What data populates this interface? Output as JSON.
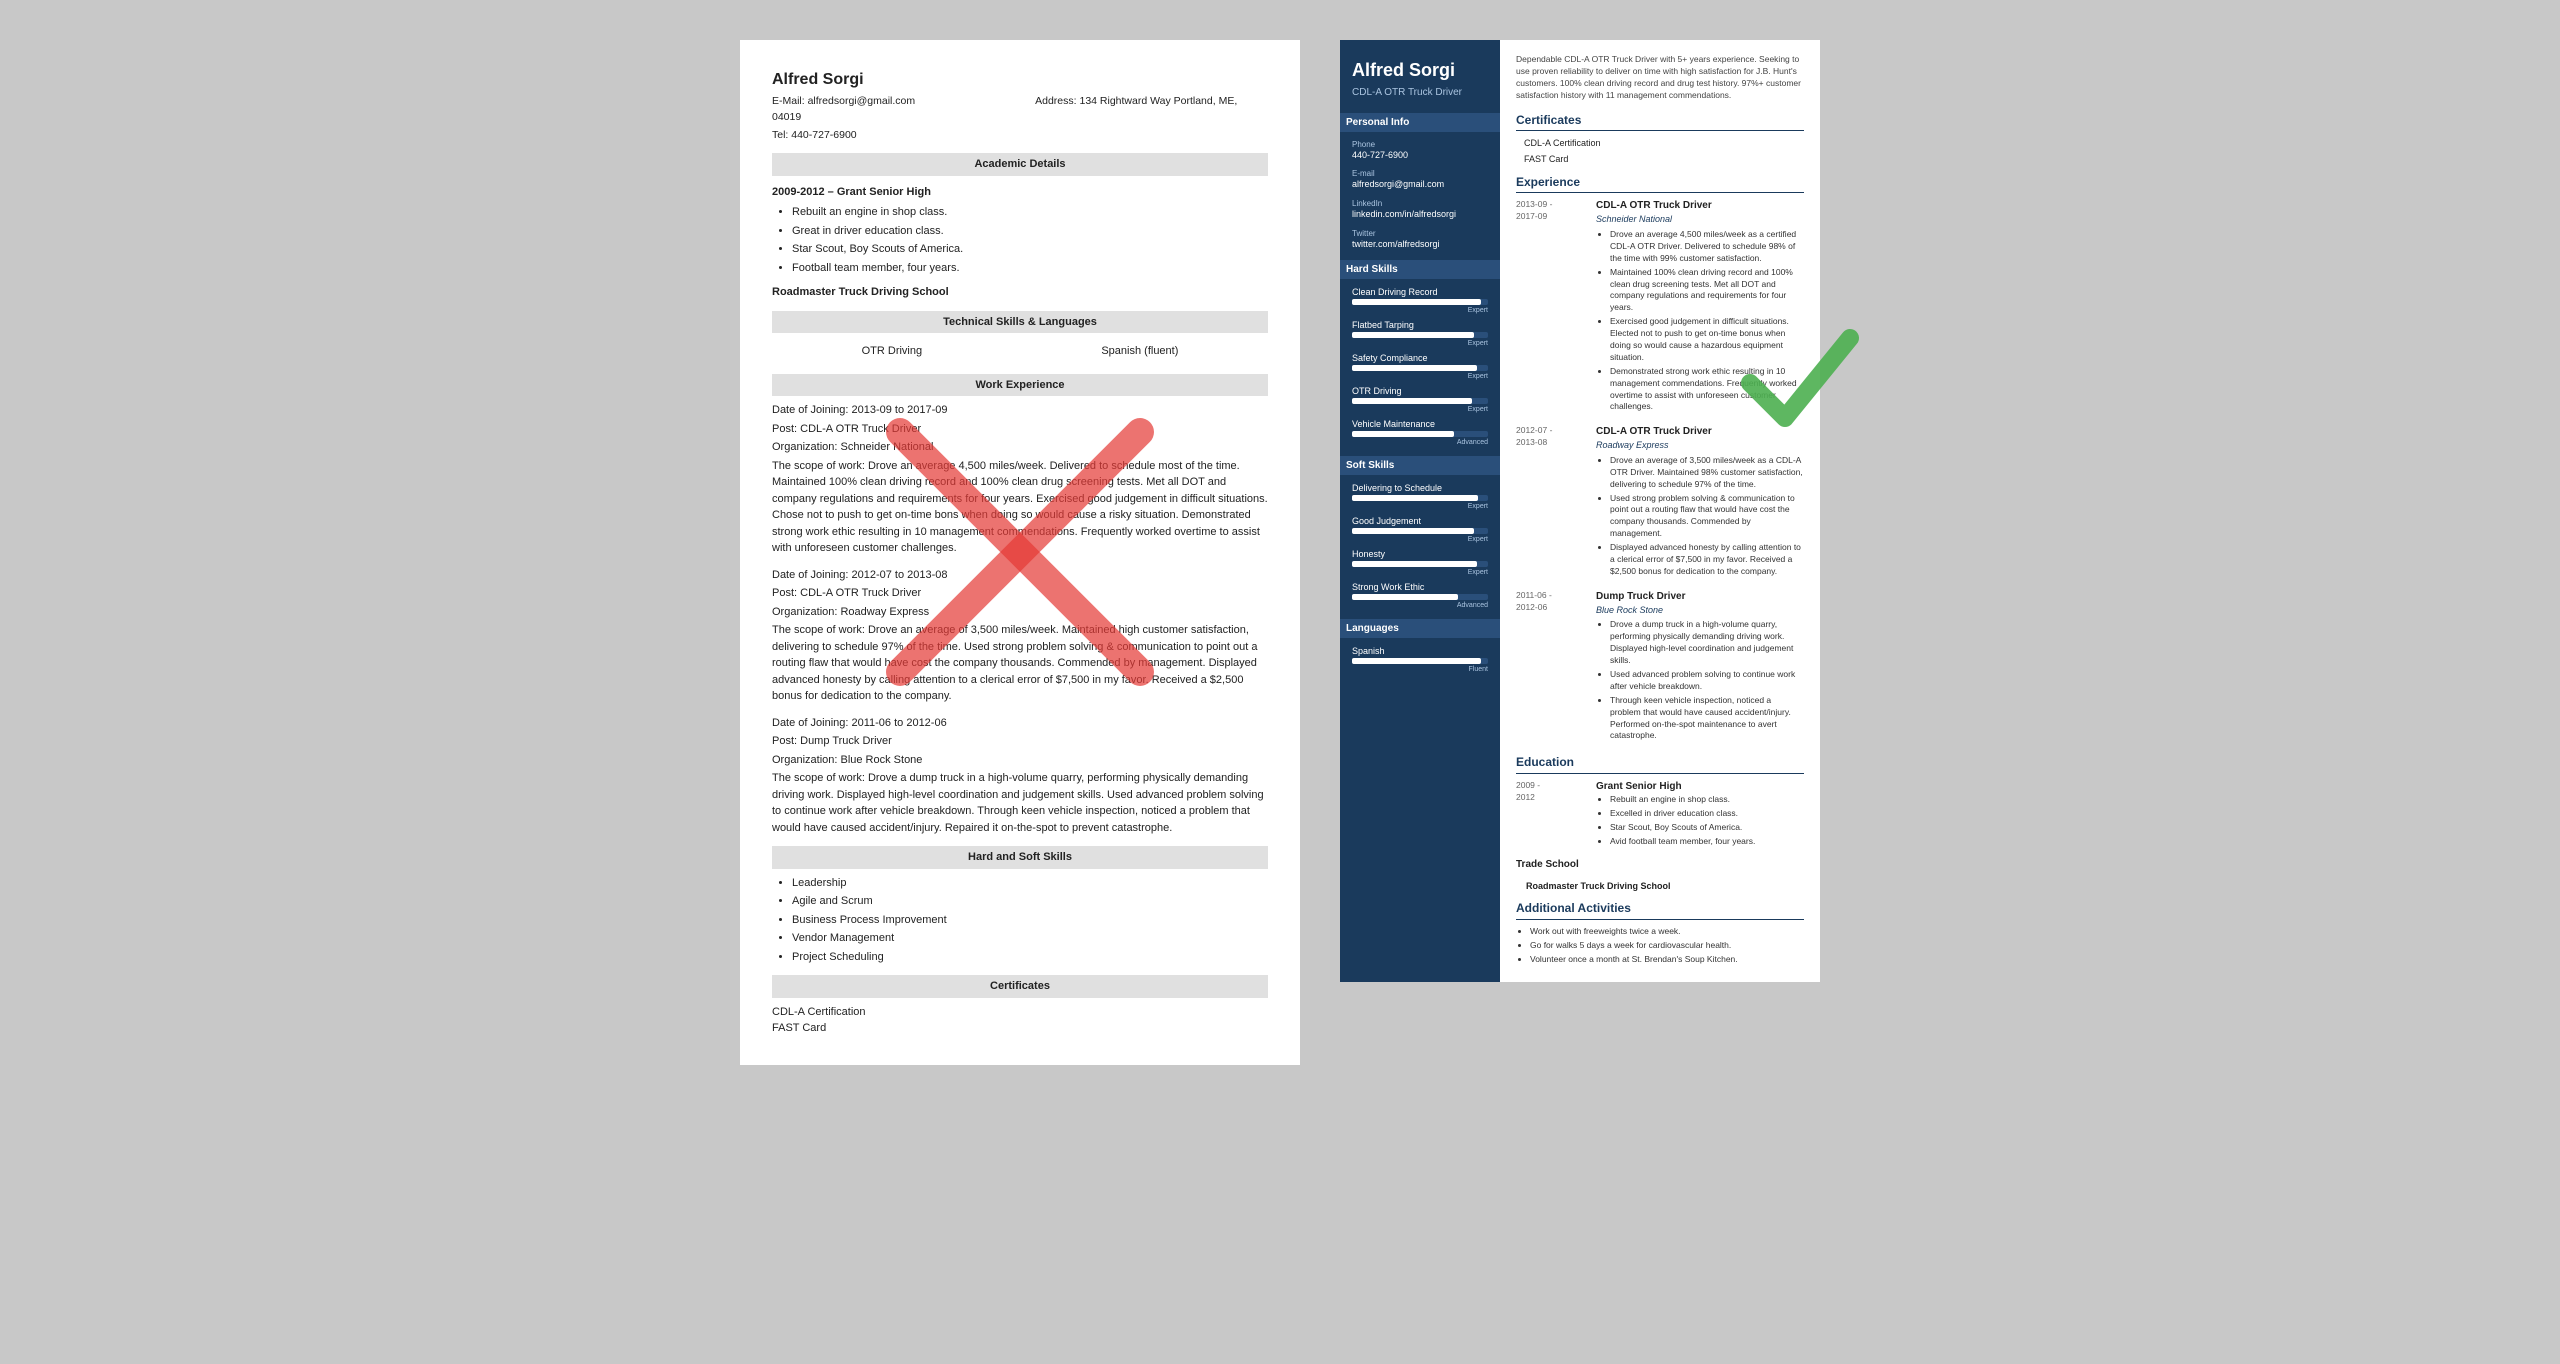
{
  "leftResume": {
    "name": "Alfred Sorgi",
    "email": "E-Mail: alfredsorgi@gmail.com",
    "address": "Address: 134 Rightward Way Portland, ME, 04019",
    "tel": "Tel: 440-727-6900",
    "sections": {
      "academic": "Academic Details",
      "academicEntry": "2009-2012 – Grant Senior High",
      "academicBullets": [
        "Rebuilt an engine in shop class.",
        "Great in driver education class.",
        "Star Scout, Boy Scouts of America.",
        "Football team member, four years."
      ],
      "tradeSchool": "Roadmaster Truck Driving School",
      "technicalSkills": "Technical Skills & Languages",
      "skills": [
        "OTR Driving",
        "Spanish (fluent)"
      ],
      "workExperience": "Work Experience",
      "workEntries": [
        {
          "dates": "Date of Joining: 2013-09 to 2017-09",
          "post": "Post: CDL-A OTR Truck Driver",
          "org": "Organization: Schneider National",
          "scope": "The scope of work: Drove an average 4,500 miles/week. Delivered to schedule most of the time. Maintained 100% clean driving record and 100% clean drug screening tests. Met all DOT and company regulations and requirements for four years. Exercised good judgement in difficult situations. Chose not to push to get on-time bons when doing so would cause a risky situation. Demonstrated strong work ethic resulting in 10 management commendations. Frequently worked overtime to assist with unforeseen customer challenges."
        },
        {
          "dates": "Date of Joining: 2012-07 to 2013-08",
          "post": "Post: CDL-A OTR Truck Driver",
          "org": "Organization: Roadway Express",
          "scope": "The scope of work: Drove an average of 3,500 miles/week. Maintained high customer satisfaction, delivering to schedule 97% of the time. Used strong problem solving & communication to point out a routing flaw that would have cost the company thousands. Commended by management. Displayed advanced honesty by calling attention to a clerical error of $7,500 in my favor. Received a $2,500 bonus for dedication to the company."
        },
        {
          "dates": "Date of Joining: 2011-06 to 2012-06",
          "post": "Post: Dump Truck Driver",
          "org": "Organization: Blue Rock Stone",
          "scope": "The scope of work: Drove a dump truck in a high-volume quarry, performing physically demanding driving work. Displayed high-level coordination and judgement skills. Used advanced problem solving to continue work after vehicle breakdown. Through keen vehicle inspection, noticed a problem that would have caused accident/injury. Repaired it on-the-spot to prevent catastrophe."
        }
      ],
      "hardSoftSkills": "Hard and Soft Skills",
      "softSkillsList": [
        "Leadership",
        "Agile and Scrum",
        "Business Process Improvement",
        "Vendor Management",
        "Project Scheduling"
      ],
      "certificates": "Certificates",
      "certList": [
        "CDL-A Certification",
        "FAST Card"
      ]
    }
  },
  "rightResume": {
    "name": "Alfred Sorgi",
    "title": "CDL-A OTR Truck Driver",
    "summary": "Dependable CDL-A OTR Truck Driver with 5+ years experience. Seeking to use proven reliability to deliver on time with high satisfaction for J.B. Hunt's customers. 100% clean driving record and drug test history. 97%+ customer satisfaction history with 11 management commendations.",
    "sidebar": {
      "personalInfoTitle": "Personal Info",
      "phone": {
        "label": "Phone",
        "value": "440-727-6900"
      },
      "email": {
        "label": "E-mail",
        "value": "alfredsorgi@gmail.com"
      },
      "linkedin": {
        "label": "LinkedIn",
        "value": "linkedin.com/in/alfredsorgi"
      },
      "twitter": {
        "label": "Twitter",
        "value": "twitter.com/alfredsorgi"
      },
      "hardSkillsTitle": "Hard Skills",
      "hardSkills": [
        {
          "name": "Clean Driving Record",
          "pct": 95,
          "label": "Expert"
        },
        {
          "name": "Flatbed Tarping",
          "pct": 90,
          "label": "Expert"
        },
        {
          "name": "Safety Compliance",
          "pct": 92,
          "label": "Expert"
        },
        {
          "name": "OTR Driving",
          "pct": 88,
          "label": "Expert"
        },
        {
          "name": "Vehicle Maintenance",
          "pct": 75,
          "label": "Advanced"
        }
      ],
      "softSkillsTitle": "Soft Skills",
      "softSkills": [
        {
          "name": "Delivering to Schedule",
          "pct": 93,
          "label": "Expert"
        },
        {
          "name": "Good Judgement",
          "pct": 90,
          "label": "Expert"
        },
        {
          "name": "Honesty",
          "pct": 92,
          "label": "Expert"
        },
        {
          "name": "Strong Work Ethic",
          "pct": 78,
          "label": "Advanced"
        }
      ],
      "languagesTitle": "Languages",
      "languages": [
        {
          "name": "Spanish",
          "pct": 95,
          "label": "Fluent"
        }
      ]
    },
    "content": {
      "certificatesTitle": "Certificates",
      "certs": [
        "CDL-A Certification",
        "FAST Card"
      ],
      "experienceTitle": "Experience",
      "experiences": [
        {
          "dateStart": "2013-09",
          "dateEnd": "2017-09",
          "title": "CDL-A OTR Truck Driver",
          "company": "Schneider National",
          "bullets": [
            "Drove an average 4,500 miles/week as a certified CDL-A OTR Driver. Delivered to schedule 98% of the time with 99% customer satisfaction.",
            "Maintained 100% clean driving record and 100% clean drug screening tests. Met all DOT and company regulations and requirements for four years.",
            "Exercised good judgement in difficult situations. Elected not to push to get on-time bonus when doing so would cause a hazardous equipment situation.",
            "Demonstrated strong work ethic resulting in 10 management commendations. Frequently worked overtime to assist with unforeseen customer challenges."
          ]
        },
        {
          "dateStart": "2012-07",
          "dateEnd": "2013-08",
          "title": "CDL-A OTR Truck Driver",
          "company": "Roadway Express",
          "bullets": [
            "Drove an average of 3,500 miles/week as a CDL-A OTR Driver. Maintained 98% customer satisfaction, delivering to schedule 97% of the time.",
            "Used strong problem solving & communication to point out a routing flaw that would have cost the company thousands. Commended by management.",
            "Displayed advanced honesty by calling attention to a clerical error of $7,500 in my favor. Received a $2,500 bonus for dedication to the company."
          ]
        },
        {
          "dateStart": "2011-06",
          "dateEnd": "2012-06",
          "title": "Dump Truck Driver",
          "company": "Blue Rock Stone",
          "bullets": [
            "Drove a dump truck in a high-volume quarry, performing physically demanding driving work. Displayed high-level coordination and judgement skills.",
            "Used advanced problem solving to continue work after vehicle breakdown.",
            "Through keen vehicle inspection, noticed a problem that would have caused accident/injury. Performed on-the-spot maintenance to avert catastrophe."
          ]
        }
      ],
      "educationTitle": "Education",
      "educations": [
        {
          "dateStart": "2009 -",
          "dateEnd": "2012",
          "school": "Grant Senior High",
          "bullets": [
            "Rebuilt an engine in shop class.",
            "Excelled in driver education class.",
            "Star Scout, Boy Scouts of America.",
            "Avid football team member, four years."
          ]
        },
        {
          "dateStart": "",
          "dateEnd": "",
          "school": "Trade School",
          "bullets": []
        },
        {
          "school": "Roadmaster Truck Driving School",
          "bullets": []
        }
      ],
      "activitiesTitle": "Additional Activities",
      "activities": [
        "Work out with freeweights twice a week.",
        "Go for walks 5 days a week for cardiovascular health.",
        "Volunteer once a month at St. Brendan's Soup Kitchen."
      ]
    }
  }
}
